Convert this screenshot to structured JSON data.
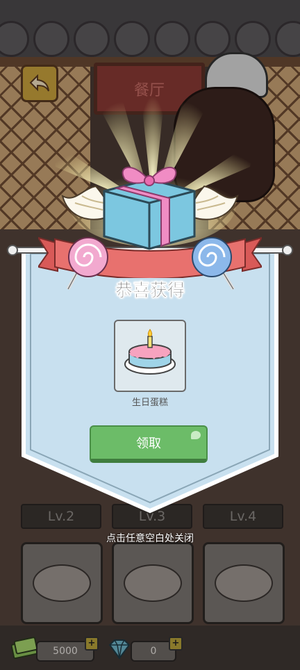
{
  "shop": {
    "sign": "餐厅"
  },
  "levels": [
    "Lv.2",
    "Lv.3",
    "Lv.4"
  ],
  "dishes": [
    {
      "icon": "sandwich-basket-icon"
    },
    {
      "icon": "ramen-bowl-icon"
    },
    {
      "icon": "fried-rice-plate-icon"
    }
  ],
  "currency": {
    "cash": "5000",
    "gems": "0",
    "plus_label": "+"
  },
  "reward": {
    "title": "恭喜获得",
    "item_name": "生日蛋糕",
    "claim_label": "领取",
    "close_hint": "点击任意空白处关闭"
  },
  "colors": {
    "banner": "#c8e0ef",
    "ribbon": "#e8716e",
    "claim_button": "#6cbc68",
    "gift_box": "#7cc7e0",
    "gift_bow": "#f08cc4"
  }
}
